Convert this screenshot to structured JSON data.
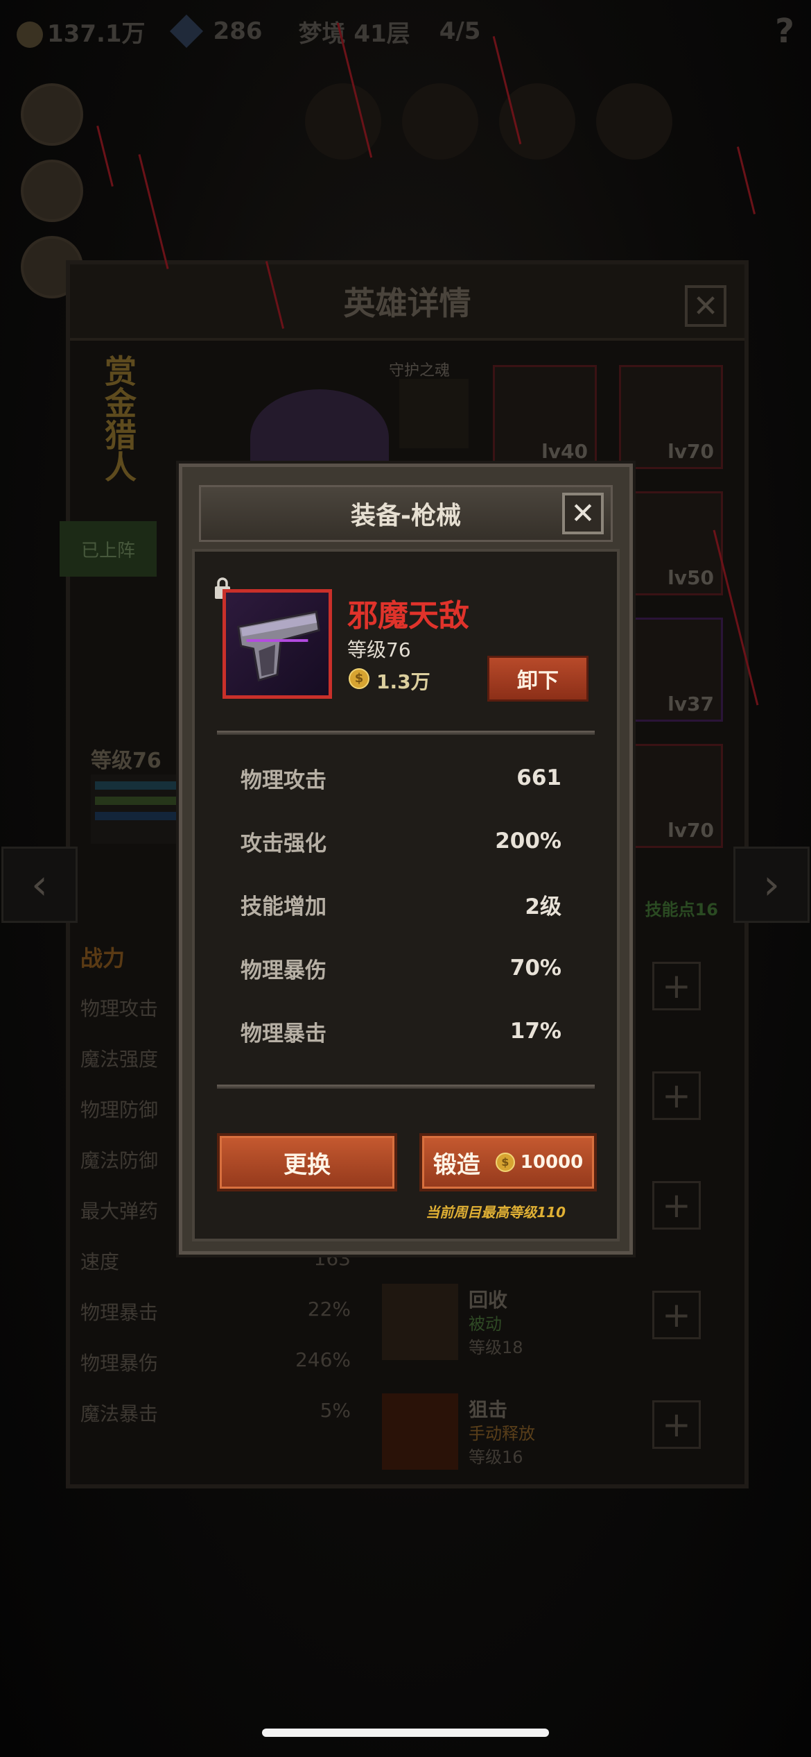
{
  "background": {
    "topbar": {
      "gold": "137.1万",
      "gems": "286",
      "dungeon": "梦境 41层",
      "skulls": "4/5",
      "help": "?"
    },
    "panel": {
      "title": "英雄详情",
      "close": "✕",
      "hero_name": "赏金猎人",
      "guard_label": "守护之魂",
      "deployed_label": "已上阵",
      "hero_level": "等级76",
      "skill_points": "技能点16",
      "equipment_slots": [
        {
          "level": "lv40"
        },
        {
          "level": "lv70"
        },
        {
          "level": "lv50"
        },
        {
          "level": "lv37"
        },
        {
          "level": "lv70"
        }
      ],
      "stats_header": "战力",
      "stats": [
        {
          "label": "物理攻击",
          "value": ""
        },
        {
          "label": "魔法强度",
          "value": ""
        },
        {
          "label": "物理防御",
          "value": ""
        },
        {
          "label": "魔法防御",
          "value": ""
        },
        {
          "label": "最大弹药",
          "value": ""
        },
        {
          "label": "速度",
          "value": "163"
        },
        {
          "label": "物理暴击",
          "value": "22%"
        },
        {
          "label": "物理暴伤",
          "value": "246%"
        },
        {
          "label": "魔法暴击",
          "value": "5%"
        }
      ],
      "skills": [
        {
          "name": "回收",
          "type": "被动",
          "level": "等级18"
        },
        {
          "name": "狙击",
          "type": "手动释放",
          "level": "等级16"
        }
      ]
    }
  },
  "modal": {
    "title": "装备-枪械",
    "close": "✕",
    "item": {
      "name": "邪魔天敌",
      "level": "等级76",
      "price": "1.3万",
      "coin_glyph": "$"
    },
    "unequip_label": "卸下",
    "stats": [
      {
        "label": "物理攻击",
        "value": "661"
      },
      {
        "label": "攻击强化",
        "value": "200%"
      },
      {
        "label": "技能增加",
        "value": "2级"
      },
      {
        "label": "物理暴伤",
        "value": "70%"
      },
      {
        "label": "物理暴击",
        "value": "17%"
      }
    ],
    "replace_label": "更换",
    "forge_label": "锻造",
    "forge_cost": "10000",
    "max_level_note": "当前周目最高等级110"
  },
  "colors": {
    "item_name": "#e0332b",
    "button_orange": "#b84a2a",
    "note_gold": "#e0b034"
  }
}
